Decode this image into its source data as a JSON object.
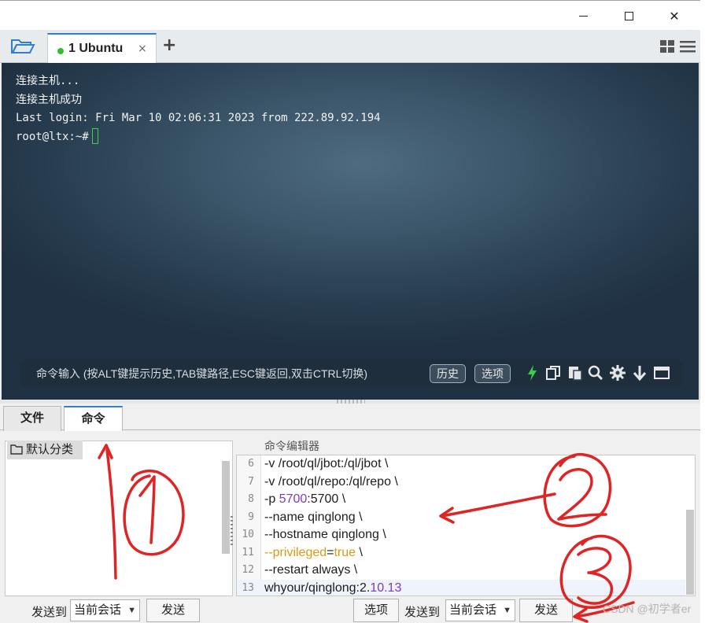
{
  "window": {
    "min_icon": "minimize-icon",
    "max_icon": "maximize-icon",
    "close_label": "✕"
  },
  "tabs": {
    "active": {
      "label": "1 Ubuntu",
      "status_color": "#2ec02e",
      "close": "×"
    },
    "add_label": "+"
  },
  "terminal": {
    "lines": [
      "连接主机...",
      "连接主机成功",
      "Last login: Fri Mar 10 02:06:31 2023 from 222.89.92.194",
      "root@ltx:~#"
    ],
    "cursor_color": "#3fd14a"
  },
  "command_bar": {
    "hint": "命令输入 (按ALT键提示历史,TAB键路径,ESC键返回,双击CTRL切换)",
    "history_button": "历史",
    "options_button": "选项"
  },
  "bottom_tabs": [
    "文件",
    "命令"
  ],
  "categories": {
    "header": "默认分类"
  },
  "editor": {
    "title": "命令编辑器",
    "lines": [
      {
        "num": "6",
        "text": "-v /root/ql/jbot:/ql/jbot \\"
      },
      {
        "num": "7",
        "text": "-v /root/ql/repo:/ql/repo \\"
      },
      {
        "num": "8",
        "pre": "-p ",
        "highlight": "5700",
        "post": ":5700 \\"
      },
      {
        "num": "9",
        "text": "--name qinglong \\"
      },
      {
        "num": "10",
        "text": "--hostname qinglong \\"
      },
      {
        "num": "11",
        "flag": "--privileged",
        "eq": "=",
        "val": "true",
        "post": " \\"
      },
      {
        "num": "12",
        "text": "--restart always \\"
      },
      {
        "num": "13",
        "pre": "whyour/qinglong:2.",
        "highlight": "10.13",
        "post": ""
      }
    ]
  },
  "footer_left": {
    "send_to_label": "发送到",
    "target": "当前会话",
    "send_button": "发送"
  },
  "footer_right": {
    "options_button": "选项",
    "send_to_label": "发送到",
    "target": "当前会话",
    "send_button": "发送"
  },
  "annotations": [
    "1",
    "2",
    "3"
  ],
  "watermark": "CSDN @初学者er",
  "colors": {
    "accent": "#2f7fd3",
    "annotation": "#e02424",
    "number_purple": "#7a3db8",
    "flag_orange": "#d99a16"
  }
}
